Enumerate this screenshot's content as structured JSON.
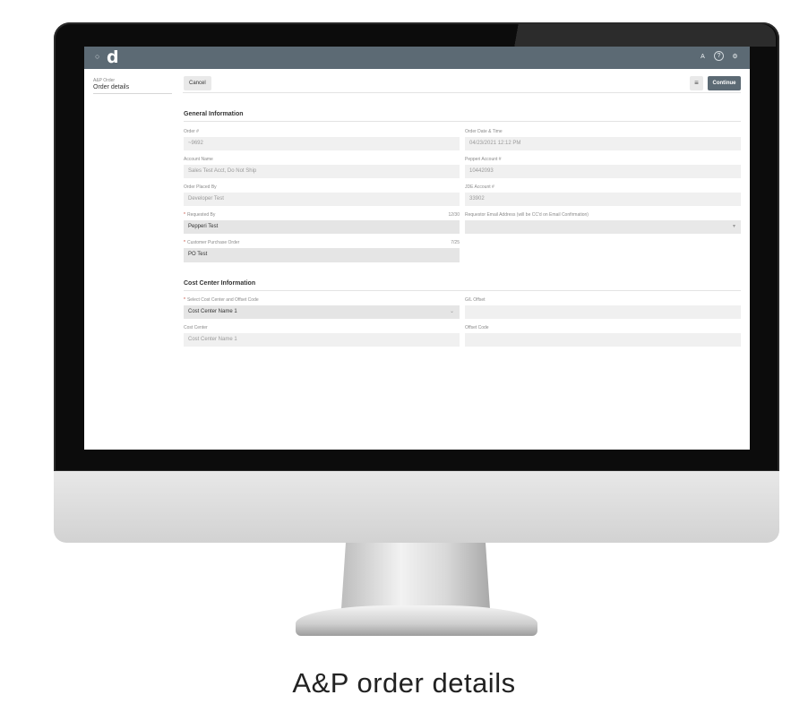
{
  "topbar": {
    "logo": "d",
    "icons": [
      "account-icon",
      "help-icon",
      "settings-icon"
    ],
    "icon_glyphs": [
      "A",
      "?",
      "⚙"
    ]
  },
  "sidebar": {
    "crumb": "A&P Order",
    "title": "Order details"
  },
  "toolbar": {
    "cancel_label": "Cancel",
    "continue_label": "Continue",
    "menu_glyph": "≡"
  },
  "general": {
    "title": "General Information",
    "order_number": {
      "label": "Order #",
      "value": "~9692"
    },
    "order_datetime": {
      "label": "Order Date & Time",
      "value": "04/23/2021 12:12 PM"
    },
    "account_name": {
      "label": "Account Name",
      "value": "Sales Test Acct, Do Not Ship"
    },
    "pepperi_account": {
      "label": "Pepperi Account #",
      "value": "10442093"
    },
    "placed_by": {
      "label": "Order Placed By",
      "value": "Developer Test"
    },
    "jde_account": {
      "label": "JDE Account #",
      "value": "33902"
    },
    "requested_by": {
      "label": "Requested By",
      "count": "12/30",
      "value": "Pepperi Test"
    },
    "requestor_email": {
      "label": "Requestor Email Address (will be CC'd on Email Confirmation)",
      "value": ""
    },
    "customer_po": {
      "label": "Customer Purchase Order",
      "count": "7/25",
      "value": "PO Test"
    }
  },
  "cost_center": {
    "title": "Cost Center Information",
    "select": {
      "label": "Select Cost Center and Offset Code",
      "value": "Cost Center Name 1"
    },
    "gl_offset": {
      "label": "G/L Offset",
      "value": ""
    },
    "cost_center_field": {
      "label": "Cost Center",
      "value": "Cost Center Name 1"
    },
    "offset_code": {
      "label": "Offset Code",
      "value": ""
    }
  },
  "caption": "A&P order details",
  "colors": {
    "topbar": "#5c6a74",
    "required": "#c0392b"
  }
}
